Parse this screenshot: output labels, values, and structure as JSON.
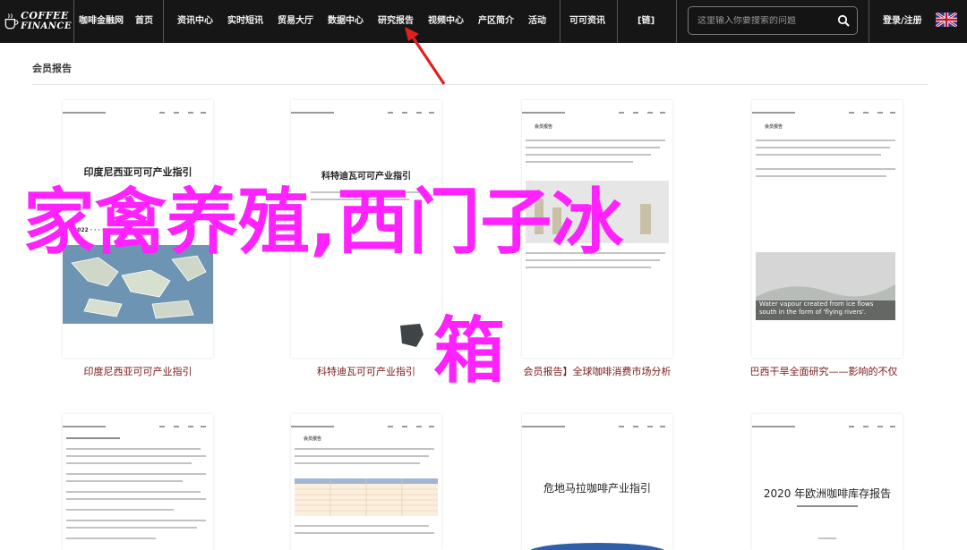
{
  "nav": {
    "logo_line1": "COFFEE",
    "logo_line2": "FINANCE",
    "items": [
      {
        "label": "咖啡金融网"
      },
      {
        "label": "首页"
      },
      {
        "label": "资讯中心"
      },
      {
        "label": "实时短讯"
      },
      {
        "label": "贸易大厅"
      },
      {
        "label": "数据中心"
      },
      {
        "label": "研究报告"
      },
      {
        "label": "视频中心"
      },
      {
        "label": "产区简介"
      },
      {
        "label": "活动"
      },
      {
        "label": "可可资讯"
      },
      {
        "label": "[链]"
      }
    ],
    "search_placeholder": "这里输入你要搜索的问题",
    "login_label": "登录/注册",
    "flag_icon": "uk-flag-icon"
  },
  "section": {
    "title": "会员报告"
  },
  "cards_row1": [
    {
      "doc_title": "印度尼西亚可可产业指引",
      "caption": "印度尼西亚可可产业指引"
    },
    {
      "doc_title": "科特迪瓦可可产业指引",
      "caption": "科特迪瓦可可产业指引"
    },
    {
      "doc_tag": "会员报告",
      "caption": "会员报告】全球咖啡消费市场分析",
      "water_text": "Water vapour created from ice flows south in the form of 'flying rivers'."
    },
    {
      "doc_tag": "会员报告",
      "caption": "巴西干旱全面研究——影响的不仅"
    }
  ],
  "cards_row2": [
    {
      "doc_tag": ""
    },
    {
      "doc_tag": "会员报告"
    },
    {
      "doc_title": "危地马拉咖啡产业指引"
    },
    {
      "doc_title": "2020 年欧洲咖啡库存报告"
    }
  ],
  "overlay": {
    "line1": "家禽养殖,西门子冰",
    "line2": "箱"
  },
  "colors": {
    "nav_bg": "#161616",
    "caption": "#7a1818",
    "overlay": "#ff22ff",
    "arrow": "#e02020"
  }
}
